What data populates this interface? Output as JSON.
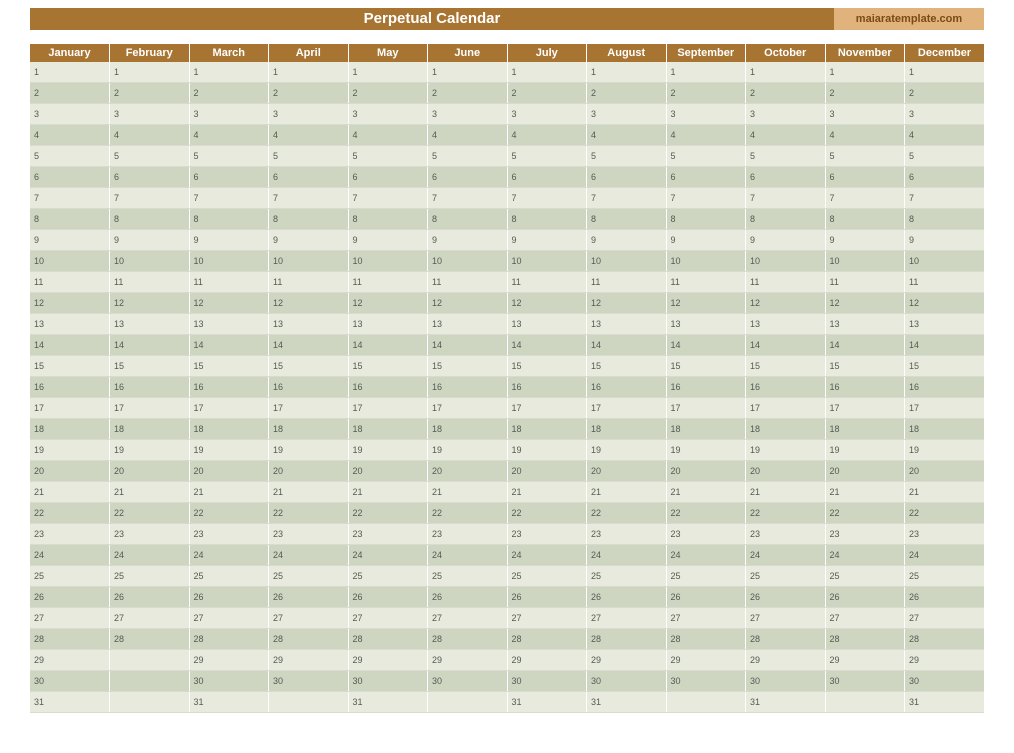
{
  "header": {
    "title": "Perpetual Calendar",
    "brand": "maiaratemplate.com"
  },
  "months": [
    {
      "name": "January",
      "days": 31
    },
    {
      "name": "February",
      "days": 28
    },
    {
      "name": "March",
      "days": 31
    },
    {
      "name": "April",
      "days": 30
    },
    {
      "name": "May",
      "days": 31
    },
    {
      "name": "June",
      "days": 30
    },
    {
      "name": "July",
      "days": 31
    },
    {
      "name": "August",
      "days": 31
    },
    {
      "name": "September",
      "days": 30
    },
    {
      "name": "October",
      "days": 31
    },
    {
      "name": "November",
      "days": 30
    },
    {
      "name": "December",
      "days": 31
    }
  ],
  "max_rows": 31,
  "colors": {
    "title_bg": "#a87432",
    "brand_bg": "#e0b27c",
    "row_light": "#e7eadd",
    "row_dark": "#ced6c2"
  }
}
